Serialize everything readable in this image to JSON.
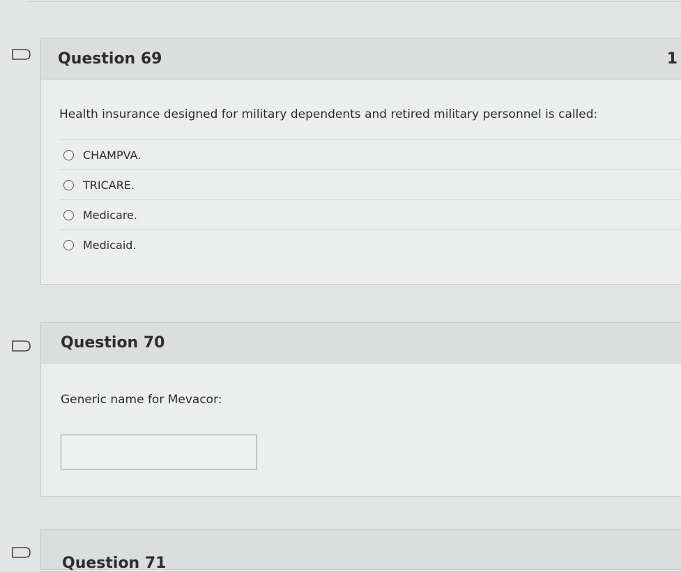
{
  "questions": [
    {
      "title": "Question 69",
      "points": "1",
      "text": "Health insurance designed for military dependents and retired military personnel is called:",
      "options": [
        "CHAMPVA.",
        "TRICARE.",
        "Medicare.",
        "Medicaid."
      ]
    },
    {
      "title": "Question 70",
      "text": "Generic name for Mevacor:",
      "answer_value": ""
    },
    {
      "title": "Question 71"
    }
  ],
  "icons": {
    "flag": "flag-outline-icon"
  }
}
